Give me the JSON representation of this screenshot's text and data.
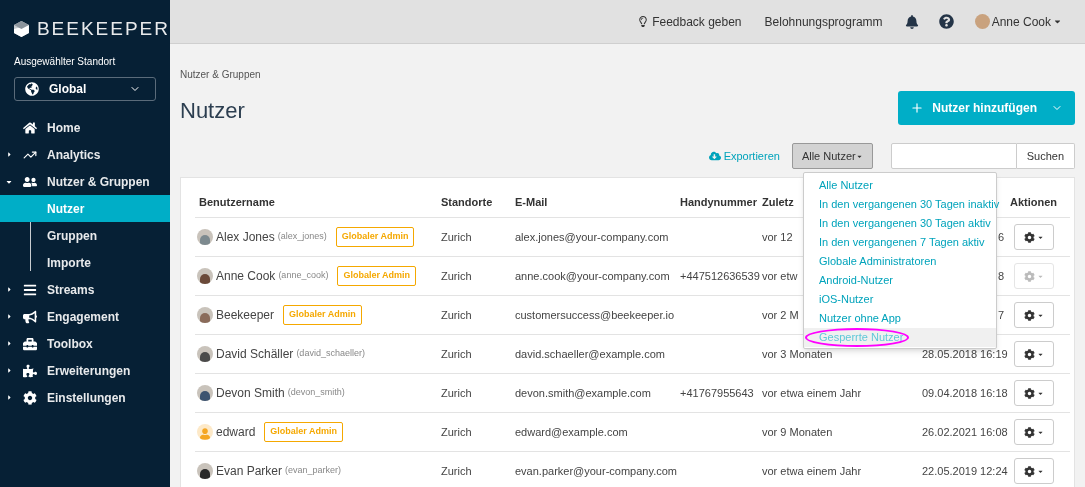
{
  "sidebar": {
    "logo": "BEEKEEPER",
    "location_label": "Ausgewählter Standort",
    "location": "Global",
    "items": [
      {
        "label": "Home",
        "expandable": false
      },
      {
        "label": "Analytics",
        "expandable": true,
        "expanded": false
      },
      {
        "label": "Nutzer & Gruppen",
        "expandable": true,
        "expanded": true,
        "children": [
          {
            "label": "Nutzer",
            "selected": true
          },
          {
            "label": "Gruppen",
            "selected": false
          },
          {
            "label": "Importe",
            "selected": false
          }
        ]
      },
      {
        "label": "Streams",
        "expandable": true,
        "expanded": false
      },
      {
        "label": "Engagement",
        "expandable": true,
        "expanded": false
      },
      {
        "label": "Toolbox",
        "expandable": true,
        "expanded": false
      },
      {
        "label": "Erweiterungen",
        "expandable": true,
        "expanded": false
      },
      {
        "label": "Einstellungen",
        "expandable": true,
        "expanded": false
      }
    ]
  },
  "topbar": {
    "feedback": "Feedback geben",
    "rewards": "Belohnungsprogramm",
    "user": "Anne Cook"
  },
  "breadcrumb": "Nutzer & Gruppen",
  "title": "Nutzer",
  "add_button": "Nutzer hinzufügen",
  "toolbar": {
    "export": "Exportieren",
    "filter": "Alle Nutzer",
    "search_button": "Suchen"
  },
  "filter_menu": {
    "items": [
      {
        "label": "Alle Nutzer",
        "highlighted": false
      },
      {
        "label": "In den vergangenen 30 Tagen inaktiv",
        "highlighted": false
      },
      {
        "label": "In den vergangenen 30 Tagen aktiv",
        "highlighted": false
      },
      {
        "label": "In den vergangenen 7 Tagen aktiv",
        "highlighted": false
      },
      {
        "label": "Globale Administratoren",
        "highlighted": false
      },
      {
        "label": "Android-Nutzer",
        "highlighted": false
      },
      {
        "label": "iOS-Nutzer",
        "highlighted": false
      },
      {
        "label": "Nutzer ohne App",
        "highlighted": false
      },
      {
        "label": "Gesperrte Nutzer",
        "highlighted": true,
        "circled": true
      }
    ]
  },
  "table": {
    "columns": [
      "Benutzername",
      "Standorte",
      "E-Mail",
      "Handynummer",
      "Zuletz",
      "Aktionen"
    ],
    "rows": [
      {
        "name": "Alex Jones",
        "username": "(alex_jones)",
        "badge": "Globaler Admin",
        "has_photo": true,
        "location": "Zurich",
        "email": "alex.jones@your-company.com",
        "last_active": "vor 12",
        "date": "6",
        "disabled": false
      },
      {
        "name": "Anne Cook",
        "username": "(anne_cook)",
        "badge": "Globaler Admin",
        "has_photo": true,
        "location": "Zurich",
        "email": "anne.cook@your-company.com",
        "phone": "+447512636539",
        "last_active": "vor etw",
        "date": "8",
        "disabled": true
      },
      {
        "name": "Beekeeper",
        "badge": "Globaler Admin",
        "has_photo": true,
        "location": "Zurich",
        "email": "customersuccess@beekeeper.io",
        "last_active": "vor 2 M",
        "date": "7",
        "disabled": false
      },
      {
        "name": "David Schäller",
        "username": "(david_schaeller)",
        "has_photo": true,
        "location": "Zurich",
        "email": "david.schaeller@example.com",
        "last_active": "vor 3 Monaten",
        "date": "28.05.2018 16:19",
        "disabled": false
      },
      {
        "name": "Devon Smith",
        "username": "(devon_smith)",
        "has_photo": true,
        "location": "Zurich",
        "email": "devon.smith@example.com",
        "phone": "+41767955643",
        "last_active": "vor etwa einem Jahr",
        "date": "09.04.2018 16:18",
        "disabled": false
      },
      {
        "name": "edward",
        "badge": "Globaler Admin",
        "has_photo": false,
        "location": "Zurich",
        "email": "edward@example.com",
        "last_active": "vor 9 Monaten",
        "date": "26.02.2021 16:08",
        "disabled": false
      },
      {
        "name": "Evan Parker",
        "username": "(evan_parker)",
        "has_photo": true,
        "location": "Zurich",
        "email": "evan.parker@your-company.com",
        "last_active": "vor etwa einem Jahr",
        "date": "22.05.2019 12:24",
        "disabled": false
      }
    ]
  }
}
